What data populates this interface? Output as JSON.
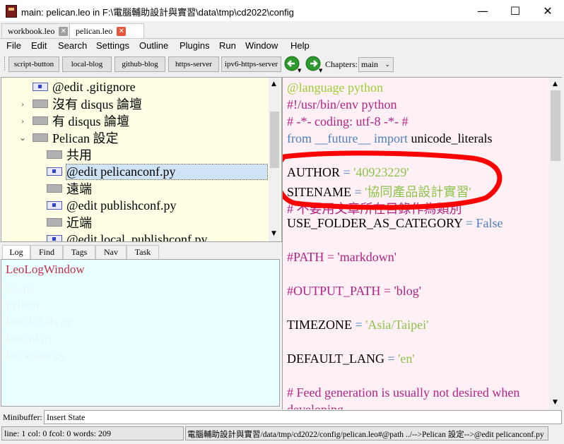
{
  "window": {
    "title": "main: pelican.leo in F:\\電腦輔助設計與實習\\data\\tmp\\cd2022\\config",
    "minimize": "—",
    "maximize": "☐",
    "close": "✕"
  },
  "file_tabs": [
    {
      "label": "workbook.leo",
      "close": "✕"
    },
    {
      "label": "pelican.leo",
      "close": "✕"
    }
  ],
  "menu": [
    "File",
    "Edit",
    "Search",
    "Settings",
    "Outline",
    "Plugins",
    "Run",
    "Window",
    "Help"
  ],
  "toolbar": {
    "buttons": [
      "script-button",
      "local-blog",
      "github-blog",
      "https-server",
      "ipv6-https-server"
    ],
    "chapters_label": "Chapters:",
    "chapters_value": "main"
  },
  "outline": {
    "nodes": [
      {
        "label": "@edit .gitignore"
      },
      {
        "label": "沒有 disqus 論壇"
      },
      {
        "label": "有 disqus 論壇"
      },
      {
        "label": "Pelican 設定"
      },
      {
        "label": "共用"
      },
      {
        "label": "@edit pelicanconf.py"
      },
      {
        "label": "遠端"
      },
      {
        "label": "@edit publishconf.py"
      },
      {
        "label": "近端"
      },
      {
        "label": "@edit local_publishconf.py"
      }
    ]
  },
  "log": {
    "tabs": [
      "Log",
      "Find",
      "Tags",
      "Nav",
      "Task"
    ],
    "lines": [
      "LeoLogWindow",
      "leo.py",
      "python",
      "leoGlobals.py",
      "leoGui.py",
      "leoNodes.py"
    ]
  },
  "body": {
    "lines": {
      "l1": "@language python",
      "l2": "#!/usr/bin/env python",
      "l3": "# -*- coding: utf-8 -*- #",
      "l4_kw1": "from",
      "l4_mod": "__future__",
      "l4_kw2": "import",
      "l4_name": "unicode_literals",
      "author_key": "AUTHOR",
      "eq": "=",
      "author_val": "'40923229'",
      "sitename_key": "SITENAME",
      "sitename_val": "'協同產品設計實習'",
      "comment_cat": "# 不要用文章所在目錄作為類別",
      "folder_key": "USE_FOLDER_AS_CATEGORY",
      "folder_val": "False",
      "path_line": "#PATH = 'markdown'",
      "output_line": "#OUTPUT_PATH = 'blog'",
      "tz_key": "TIMEZONE",
      "tz_val": "'Asia/Taipei'",
      "lang_key": "DEFAULT_LANG",
      "lang_val": "'en'",
      "feed_comment": "# Feed generation is usually not desired when",
      "feed_comment2": "developing"
    },
    "colors": {
      "directive": "#9acd32",
      "comment": "#b22285",
      "keyword": "#4a7fc0",
      "string": "#8bc34a",
      "plain": "#000000",
      "annotation": "#ff0000"
    }
  },
  "minibuffer": {
    "label": "Minibuffer:",
    "value": "Insert State"
  },
  "status": {
    "left": "line: 1 col: 0  fcol: 0 words: 209",
    "right": "電腦輔助設計與實習/data/tmp/cd2022/config/pelican.leo#@path ../-->Pelican 設定-->@edit pelicanconf.py"
  }
}
